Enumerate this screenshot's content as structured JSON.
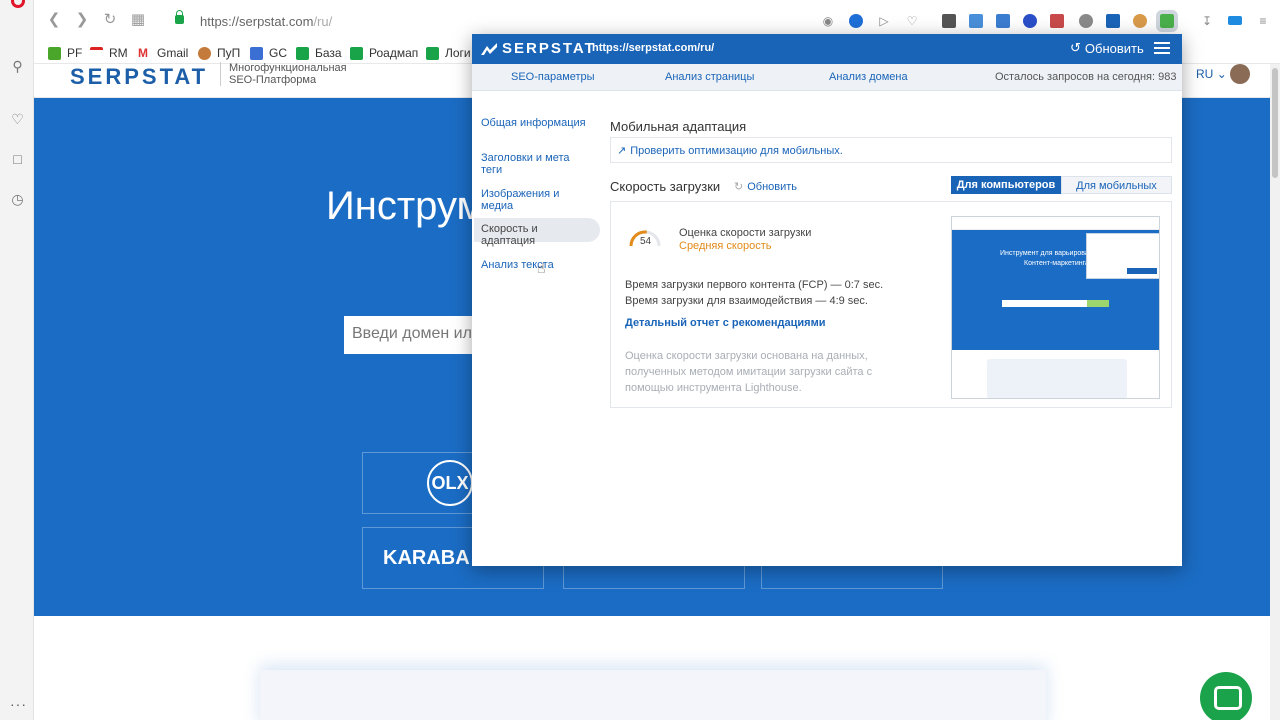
{
  "browser": {
    "url_host": "https://serpstat.com",
    "url_path": "/ru/",
    "bookmarks": [
      "PF",
      "RM",
      "Gmail",
      "ПуП",
      "GC",
      "База",
      "Роадмап",
      "Логи"
    ]
  },
  "site": {
    "logo": "SERPSTAT",
    "logo_sub_line1": "Многофункциональная",
    "logo_sub_line2": "SEO-Платформа",
    "lang": "RU",
    "hero_title": "Инструм",
    "search_placeholder": "Введи домен ил",
    "client_logo_1": "OLX",
    "client_logo_2": "KARABA"
  },
  "popup": {
    "logo": "SERPSTAT",
    "url": "https://serpstat.com/ru/",
    "refresh_label": "Обновить",
    "tabs": [
      "SEO-параметры",
      "Анализ страницы",
      "Анализ домена"
    ],
    "quota": "Осталось запросов на сегодня: 983",
    "menu": [
      {
        "label": "Общая информация"
      },
      {
        "label": "Заголовки и мета теги"
      },
      {
        "label": "Изображения и медиа"
      },
      {
        "label": "Скорость и адаптация"
      },
      {
        "label": "Анализ текста"
      }
    ],
    "mobile": {
      "title": "Мобильная адаптация",
      "link": "Проверить оптимизацию для мобильных."
    },
    "speed": {
      "title": "Скорость загрузки",
      "refresh": "Обновить",
      "toggle_desktop": "Для компьютеров",
      "toggle_mobile": "Для мобильных",
      "score": 54,
      "score_label": "Оценка скорости загрузки",
      "score_category": "Средняя скорость",
      "fcp": "Время загрузки первого контента (FCP) — 0:7 sec.",
      "tti": "Время загрузки для взаимодействия — 4:9 sec.",
      "report_link": "Детальный отчет с рекомендациями",
      "footnote": "Оценка скорости загрузки основана на данных, полученных методом имитации загрузки сайта с помощью инструмента Lighthouse."
    },
    "preview": {
      "title_line1": "Инструмент для варьирования",
      "title_line2": "Контент-маркетинга"
    }
  },
  "colors": {
    "brand_blue": "#1a64b8",
    "hero_blue": "#1b6cc4",
    "score_orange": "#e28a1a",
    "opera_red": "#e0162b"
  }
}
